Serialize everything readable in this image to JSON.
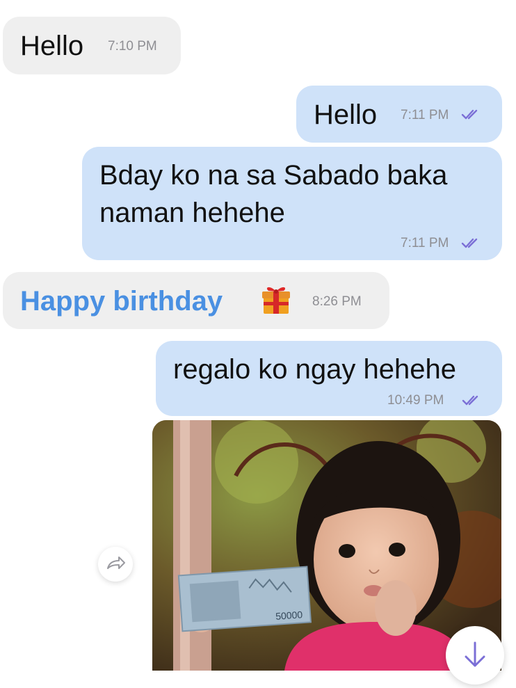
{
  "messages": [
    {
      "direction": "incoming",
      "text": "Hello",
      "time": "7:10 PM"
    },
    {
      "direction": "outgoing",
      "text": "Hello",
      "time": "7:11 PM",
      "status": "read"
    },
    {
      "direction": "outgoing",
      "text_lines": [
        "Bday ko na sa Sabado baka",
        "naman hehehe"
      ],
      "time": "7:11 PM",
      "status": "read"
    },
    {
      "direction": "incoming",
      "text": "Happy birthday",
      "emoji": "gift-emoji",
      "time": "8:26 PM"
    },
    {
      "direction": "outgoing",
      "text": "regalo ko ngay hehehe",
      "time": "10:49 PM",
      "status": "read"
    }
  ],
  "media": {
    "type": "gif-image",
    "banknote_value": "50000"
  },
  "controls": {
    "forward_icon": "forward-arrow-icon",
    "scroll_down_icon": "arrow-down-icon"
  },
  "colors": {
    "incoming_bubble": "#efefef",
    "outgoing_bubble": "#cfe2f9",
    "accent": "#4a90e2",
    "read_ticks": "#7b6fd6",
    "timestamp": "#8e8e93"
  }
}
